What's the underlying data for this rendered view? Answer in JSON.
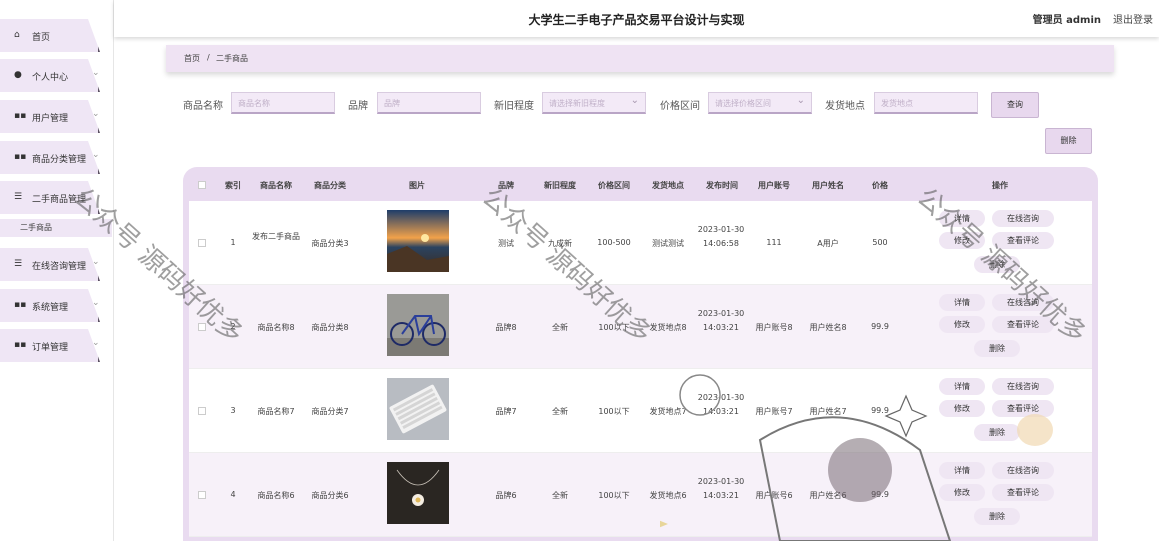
{
  "header": {
    "title": "大学生二手电子产品交易平台设计与实现",
    "admin": "管理员 admin",
    "logout": "退出登录"
  },
  "sidebar": {
    "items": [
      {
        "label": "首页",
        "icon": "home-icon"
      },
      {
        "label": "个人中心",
        "icon": "user-icon"
      },
      {
        "label": "用户管理",
        "icon": "grid-icon"
      },
      {
        "label": "商品分类管理",
        "icon": "grid-icon"
      },
      {
        "label": "二手商品管理",
        "icon": "sliders-icon"
      },
      {
        "label": "在线咨询管理",
        "icon": "list-icon"
      },
      {
        "label": "系统管理",
        "icon": "grid-icon"
      },
      {
        "label": "订单管理",
        "icon": "grid-icon"
      }
    ],
    "sub_item": "二手商品"
  },
  "breadcrumb": {
    "home": "首页",
    "sep": "/",
    "current": "二手商品"
  },
  "filters": {
    "name_label": "商品名称",
    "name_placeholder": "商品名称",
    "brand_label": "品牌",
    "brand_placeholder": "品牌",
    "condition_label": "新旧程度",
    "condition_placeholder": "请选择新旧程度",
    "price_label": "价格区间",
    "price_placeholder": "请选择价格区间",
    "location_label": "发货地点",
    "location_placeholder": "发货地点",
    "search_btn": "查询",
    "delete_btn": "删除"
  },
  "table": {
    "headers": [
      "索引",
      "商品名称",
      "商品分类",
      "图片",
      "品牌",
      "新旧程度",
      "价格区间",
      "发货地点",
      "发布时间",
      "用户账号",
      "用户姓名",
      "价格",
      "操作"
    ],
    "rows": [
      {
        "idx": "1",
        "name": "发布二手商品",
        "cat": "商品分类3",
        "brand": "测试",
        "cond": "九成新",
        "range": "100-500",
        "loc": "测试测试",
        "time": "2023-01-30 14:06:58",
        "acct": "111",
        "uname": "A用户",
        "price": "500"
      },
      {
        "idx": "2",
        "name": "商品名称8",
        "cat": "商品分类8",
        "brand": "品牌8",
        "cond": "全新",
        "range": "100以下",
        "loc": "发货地点8",
        "time": "2023-01-30 14:03:21",
        "acct": "用户账号8",
        "uname": "用户姓名8",
        "price": "99.9"
      },
      {
        "idx": "3",
        "name": "商品名称7",
        "cat": "商品分类7",
        "brand": "品牌7",
        "cond": "全新",
        "range": "100以下",
        "loc": "发货地点7",
        "time": "2023-01-30 14:03:21",
        "acct": "用户账号7",
        "uname": "用户姓名7",
        "price": "99.9"
      },
      {
        "idx": "4",
        "name": "商品名称6",
        "cat": "商品分类6",
        "brand": "品牌6",
        "cond": "全新",
        "range": "100以下",
        "loc": "发货地点6",
        "time": "2023-01-30 14:03:21",
        "acct": "用户账号6",
        "uname": "用户姓名6",
        "price": "99.9"
      }
    ],
    "actions": {
      "detail": "详情",
      "consult": "在线咨询",
      "edit": "修改",
      "reviews": "查看评论",
      "delete": "删除"
    }
  },
  "watermark": "公众号 源码好优多"
}
